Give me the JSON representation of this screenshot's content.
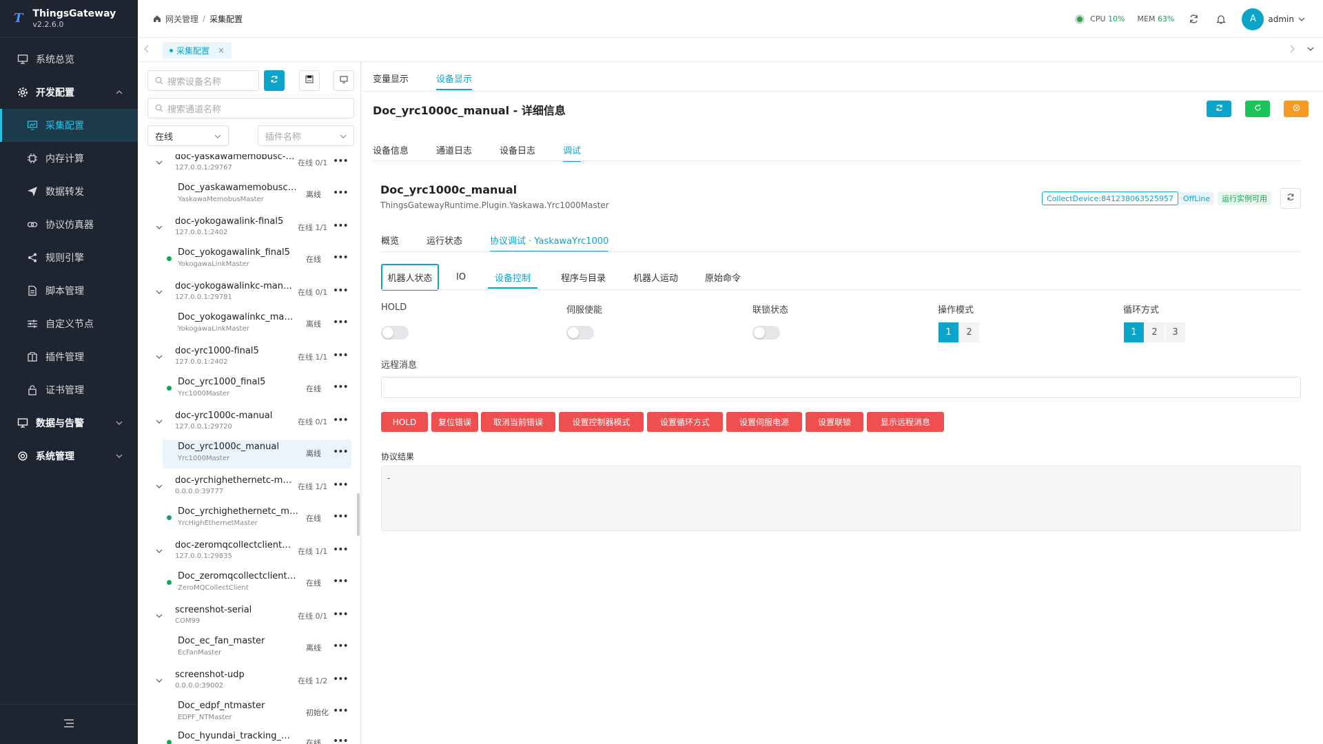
{
  "app": {
    "name": "ThingsGateway",
    "version": "v2.2.6.0",
    "logo_glyph": "T"
  },
  "sidebar": {
    "items": [
      {
        "label": "系统总览",
        "icon": "monitor-icon"
      },
      {
        "label": "开发配置",
        "icon": "gear-icon"
      },
      {
        "label": "采集配置",
        "icon": "chart-icon"
      },
      {
        "label": "内存计算",
        "icon": "chip-icon"
      },
      {
        "label": "数据转发",
        "icon": "send-icon"
      },
      {
        "label": "协议仿真器",
        "icon": "link-icon"
      },
      {
        "label": "规则引擎",
        "icon": "share-icon"
      },
      {
        "label": "脚本管理",
        "icon": "file-icon"
      },
      {
        "label": "自定义节点",
        "icon": "sliders-icon"
      },
      {
        "label": "插件管理",
        "icon": "package-icon"
      },
      {
        "label": "证书管理",
        "icon": "lock-icon"
      },
      {
        "label": "数据与告警",
        "icon": "monitor-icon"
      },
      {
        "label": "系统管理",
        "icon": "gear-icon"
      }
    ]
  },
  "header": {
    "breadcrumb": [
      "网关管理",
      "采集配置"
    ],
    "cpu_label": "CPU",
    "cpu_value": "10%",
    "mem_label": "MEM",
    "mem_value": "63%",
    "user_initial": "A",
    "user_name": "admin"
  },
  "tabbar": {
    "tab_label": "采集配置",
    "close": "×"
  },
  "devpanel": {
    "search_device_placeholder": "搜索设备名称",
    "search_channel_placeholder": "搜索通道名称",
    "status_select": "在线",
    "plugin_select_placeholder": "插件名称",
    "more_glyph": "•••",
    "channels": [
      {
        "name": "doc-yaskawamemobusc-m...",
        "addr": "127.0.0.1:29767",
        "status": "在线 0/1",
        "devices": [
          {
            "name": "Doc_yaskawamemobusc_ma...",
            "plugin": "YaskawaMemobusMaster",
            "status": "离线",
            "online": false
          }
        ]
      },
      {
        "name": "doc-yokogawalink-final5",
        "addr": "127.0.0.1:2402",
        "status": "在线 1/1",
        "devices": [
          {
            "name": "Doc_yokogawalink_final5",
            "plugin": "YokogawaLinkMaster",
            "status": "在线",
            "online": true
          }
        ]
      },
      {
        "name": "doc-yokogawalinkc-manual",
        "addr": "127.0.0.1:29781",
        "status": "在线 0/1",
        "devices": [
          {
            "name": "Doc_yokogawalinkc_manual",
            "plugin": "YokogawaLinkMaster",
            "status": "离线",
            "online": false
          }
        ]
      },
      {
        "name": "doc-yrc1000-final5",
        "addr": "127.0.0.1:2402",
        "status": "在线 1/1",
        "devices": [
          {
            "name": "Doc_yrc1000_final5",
            "plugin": "Yrc1000Master",
            "status": "在线",
            "online": true
          }
        ]
      },
      {
        "name": "doc-yrc1000c-manual",
        "addr": "127.0.0.1:29720",
        "status": "在线 0/1",
        "devices": [
          {
            "name": "Doc_yrc1000c_manual",
            "plugin": "Yrc1000Master",
            "status": "离线",
            "online": false,
            "selected": true
          }
        ]
      },
      {
        "name": "doc-yrchighethernetc-man...",
        "addr": "0.0.0.0:39777",
        "status": "在线 1/1",
        "devices": [
          {
            "name": "Doc_yrchighethernetc_manual",
            "plugin": "YrcHighEthernetMaster",
            "status": "在线",
            "online": true
          }
        ]
      },
      {
        "name": "doc-zeromqcollectclientfin...",
        "addr": "127.0.0.1:29835",
        "status": "在线 1/1",
        "devices": [
          {
            "name": "Doc_zeromqcollectclientfinal...",
            "plugin": "ZeroMQCollectClient",
            "status": "在线",
            "online": true
          }
        ]
      },
      {
        "name": "screenshot-serial",
        "addr": "COM99",
        "status": "在线 0/1",
        "devices": [
          {
            "name": "Doc_ec_fan_master",
            "plugin": "EcFanMaster",
            "status": "离线",
            "online": false
          }
        ]
      },
      {
        "name": "screenshot-udp",
        "addr": "0.0.0.0:39002",
        "status": "在线 1/2",
        "devices": [
          {
            "name": "Doc_edpf_ntmaster",
            "plugin": "EDPF_NTMaster",
            "status": "初始化",
            "online": false
          },
          {
            "name": "Doc_hyundai_tracking_master",
            "plugin": "",
            "status": "在线",
            "online": true
          }
        ]
      }
    ]
  },
  "main": {
    "top_tabs": [
      "变量显示",
      "设备显示"
    ],
    "detail_title": "Doc_yrc1000c_manual - 详细信息",
    "detail_tabs": [
      "设备信息",
      "通道日志",
      "设备日志",
      "调试"
    ],
    "device_name": "Doc_yrc1000c_manual",
    "device_class": "ThingsGatewayRuntime.Plugin.Yaskawa.Yrc1000Master",
    "tags": {
      "collect": "CollectDevice:841238063525957",
      "offline": "OffLine",
      "runtime": "运行实例可用"
    },
    "sub_tabs": [
      "概览",
      "运行状态",
      "协议调试 · YaskawaYrc1000"
    ],
    "debug_tabs": [
      "机器人状态",
      "IO",
      "设备控制",
      "程序与目录",
      "机器人运动",
      "原始命令"
    ],
    "controls": {
      "hold": "HOLD",
      "servo": "伺服使能",
      "interlock": "联锁状态",
      "op_mode": "操作模式",
      "op_mode_options": [
        "1",
        "2"
      ],
      "cycle_mode": "循环方式",
      "cycle_mode_options": [
        "1",
        "2",
        "3"
      ]
    },
    "remote_msg_label": "远程消息",
    "buttons": [
      "HOLD",
      "复位错误",
      "取消当前错误",
      "设置控制器模式",
      "设置循环方式",
      "设置伺服电源",
      "设置联锁",
      "显示远程消息"
    ],
    "result_label": "协议结果",
    "result_value": "-"
  },
  "colors": {
    "accent": "#0ca5c9",
    "danger": "#f04f4f",
    "success": "#18a058",
    "warning": "#f59a23",
    "sidebar_bg": "#1e2530"
  }
}
